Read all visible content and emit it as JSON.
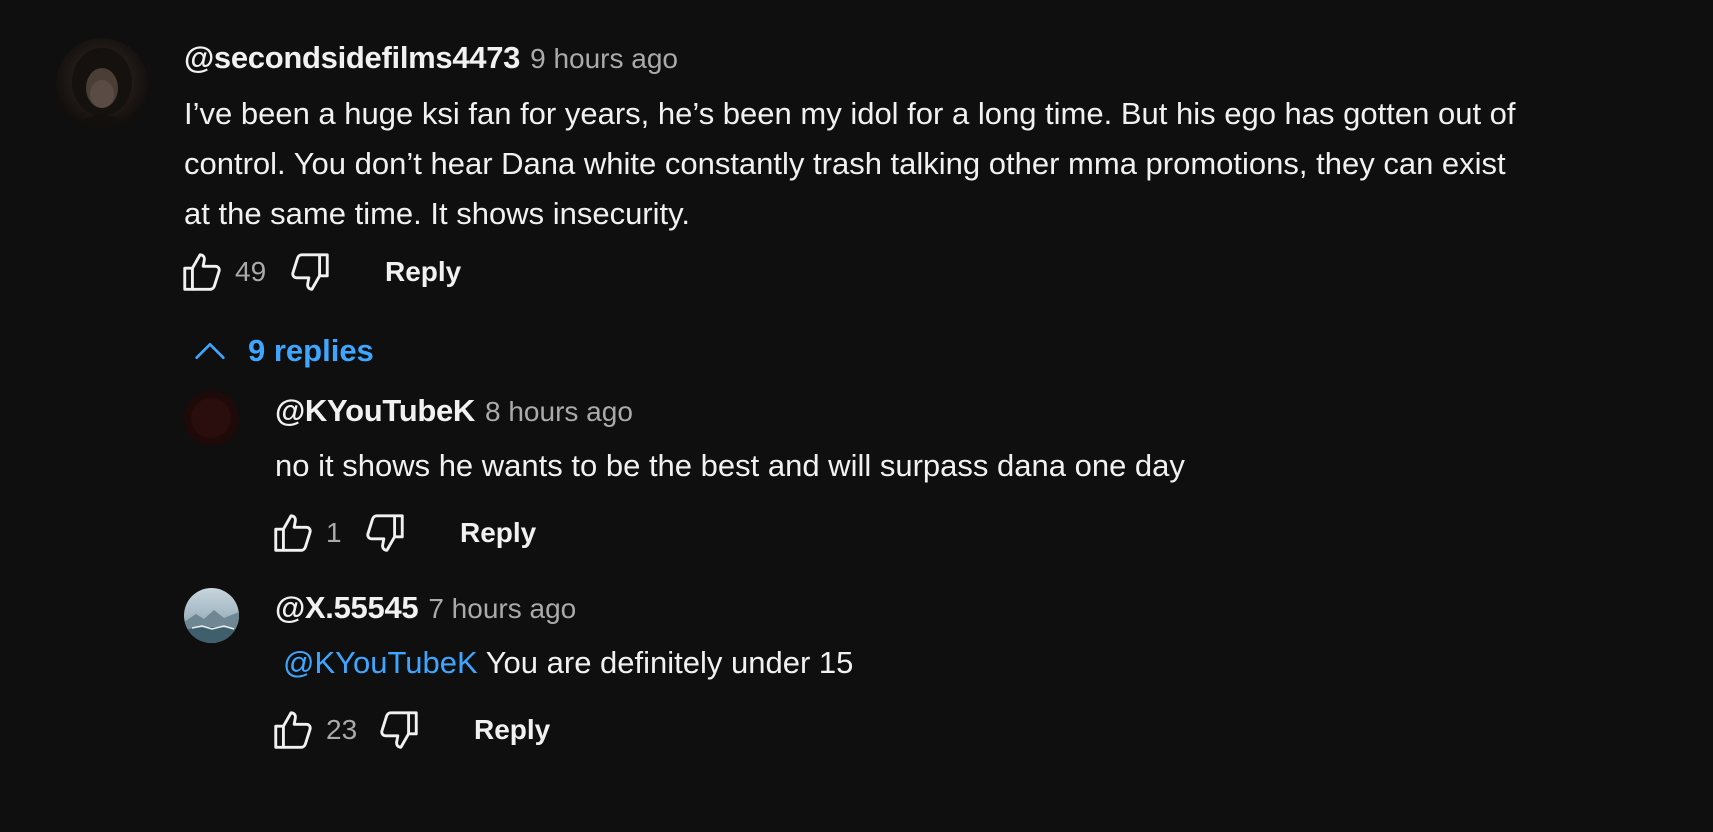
{
  "comment": {
    "author": "@secondsidefilms4473",
    "time": "9 hours ago",
    "text": "I’ve been a huge ksi fan for years, he’s been my idol for a long time. But his ego has gotten out of control. You don’t hear Dana white constantly trash talking other mma promotions, they can exist at the same time. It shows insecurity.",
    "likes": "49",
    "reply_label": "Reply"
  },
  "replies_toggle": {
    "label": "9 replies",
    "icon": "chevron-up-icon"
  },
  "replies": [
    {
      "author": "@KYouTubeK",
      "time": "8 hours ago",
      "mention": "",
      "text": "no it shows he wants to be the best and will surpass dana one day",
      "likes": "1",
      "reply_label": "Reply"
    },
    {
      "author": "@X.55545",
      "time": "7 hours ago",
      "mention": "@KYouTubeK",
      "text": "You are definitely under 15",
      "likes": "23",
      "reply_label": "Reply"
    }
  ],
  "colors": {
    "background": "#0f0f0f",
    "primary_text": "#f1f1f1",
    "secondary_text": "#aaaaaa",
    "link": "#3ea6ff"
  },
  "icons": [
    "thumb-up-icon",
    "thumb-down-icon",
    "chevron-up-icon"
  ]
}
